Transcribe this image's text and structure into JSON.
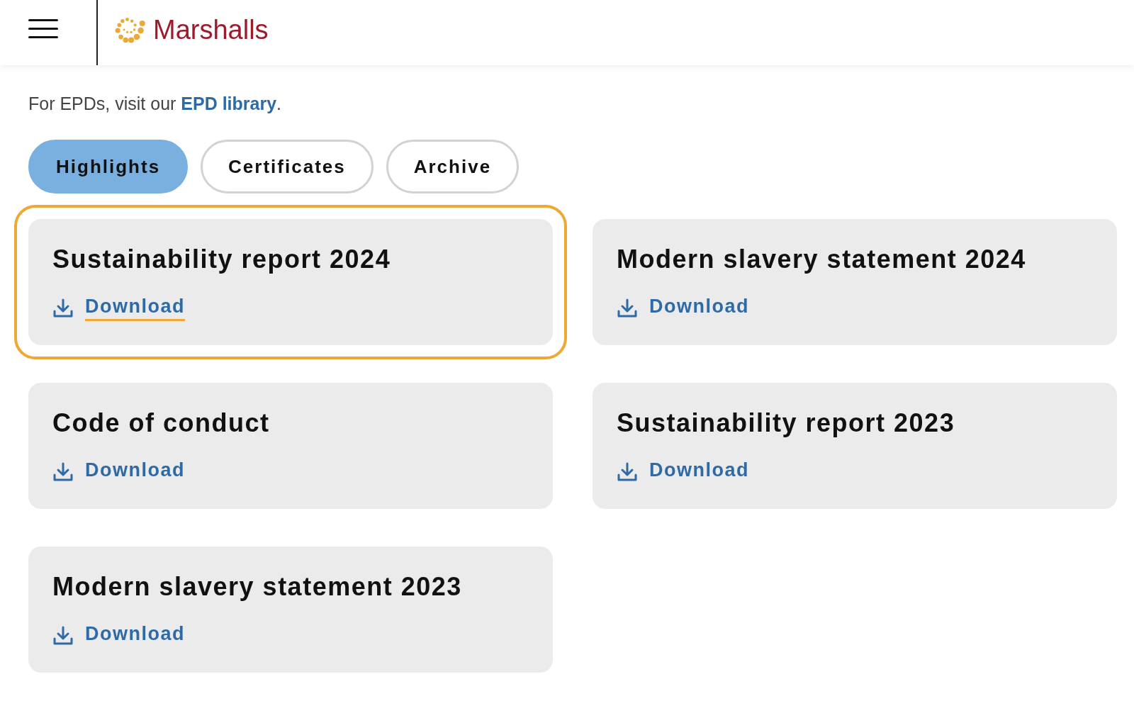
{
  "header": {
    "logo_text": "Marshalls"
  },
  "intro": {
    "text": "For EPDs, visit our ",
    "link": "EPD library",
    "after": "."
  },
  "tabs": [
    {
      "label": "Highlights",
      "selected": true
    },
    {
      "label": "Certificates",
      "selected": false
    },
    {
      "label": "Archive",
      "selected": false
    }
  ],
  "documents": [
    {
      "title": "Sustainability report 2024",
      "link": "Download",
      "focused": true
    },
    {
      "title": "Modern slavery statement 2024",
      "link": "Download",
      "focused": false
    },
    {
      "title": "Code of conduct",
      "link": "Download",
      "focused": false
    },
    {
      "title": "Sustainability report 2023",
      "link": "Download",
      "focused": false
    },
    {
      "title": "Modern slavery statement 2023",
      "link": "Download",
      "focused": false
    }
  ]
}
